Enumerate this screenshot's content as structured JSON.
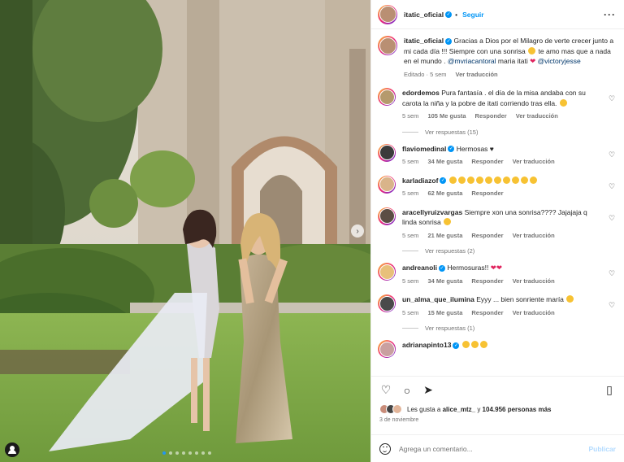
{
  "post": {
    "image_alt": "",
    "carousel_dots": 8,
    "carousel_active": 0
  },
  "header": {
    "username": "itatic_oficial",
    "follow_label": "Seguir",
    "more_icon": "more-icon"
  },
  "caption": {
    "username": "itatic_oficial",
    "text_1": "Gracias a Dios por el Milagro de verte crecer junto a mi cada día !!! Siempre con una sonrisa",
    "text_2": "te amo mas que a nada en el mundo .",
    "mention_1": "@mvriacantoral",
    "text_3": "maria itati",
    "mention_2": "@victoryjesse",
    "edited": "Editado · 5 sem",
    "translate": "Ver traducción"
  },
  "comments": [
    {
      "username": "edordemos",
      "verified": false,
      "text": "Pura fantasía . el día de la misa andaba con su carota la niña y la pobre de itati corriendo tras ella.",
      "time": "5 sem",
      "likes": "105 Me gusta",
      "reply": "Responder",
      "translate": "Ver traducción",
      "replies": "Ver respuestas (15)",
      "color": "#b59a6d"
    },
    {
      "username": "flaviomedinal",
      "verified": true,
      "text": "Hermosas ♥",
      "time": "5 sem",
      "likes": "34 Me gusta",
      "reply": "Responder",
      "translate": "Ver traducción",
      "replies": "",
      "color": "#3b3b3b"
    },
    {
      "username": "karladiazof",
      "verified": true,
      "text": "",
      "time": "5 sem",
      "likes": "62 Me gusta",
      "reply": "Responder",
      "translate": "",
      "replies": "",
      "color": "#d9b48a"
    },
    {
      "username": "aracellyruizvargas",
      "verified": false,
      "text": "Siempre xon una sonrisa???? Jajajaja q linda sonrisa",
      "time": "5 sem",
      "likes": "21 Me gusta",
      "reply": "Responder",
      "translate": "Ver traducción",
      "replies": "Ver respuestas (2)",
      "color": "#5b4d44"
    },
    {
      "username": "andreanoli",
      "verified": true,
      "text": "Hermosuras!!",
      "time": "5 sem",
      "likes": "34 Me gusta",
      "reply": "Responder",
      "translate": "Ver traducción",
      "replies": "",
      "color": "#e8c07a"
    },
    {
      "username": "un_alma_que_ilumina",
      "verified": false,
      "text": "Eyyy ... bien sonriente maría",
      "time": "5 sem",
      "likes": "15 Me gusta",
      "reply": "Responder",
      "translate": "Ver traducción",
      "replies": "Ver respuestas (1)",
      "color": "#4a4a4a"
    },
    {
      "username": "adrianapinto13",
      "verified": true,
      "text": "",
      "time": "",
      "likes": "",
      "reply": "",
      "translate": "",
      "replies": "",
      "color": "#c9a0a0"
    }
  ],
  "actions": {
    "like_icon": "heart-icon",
    "comment_icon": "comment-icon",
    "share_icon": "share-icon",
    "save_icon": "bookmark-icon"
  },
  "likes_summary": {
    "prefix": "Les gusta a",
    "user": "alice_mtz_",
    "suffix": "y",
    "count": "104.956 personas más"
  },
  "date": "3 de noviembre",
  "add_comment": {
    "placeholder": "Agrega un comentario...",
    "post_label": "Publicar"
  },
  "colors": {
    "accent": "#0095f6",
    "text": "#262626",
    "muted": "#737373"
  }
}
